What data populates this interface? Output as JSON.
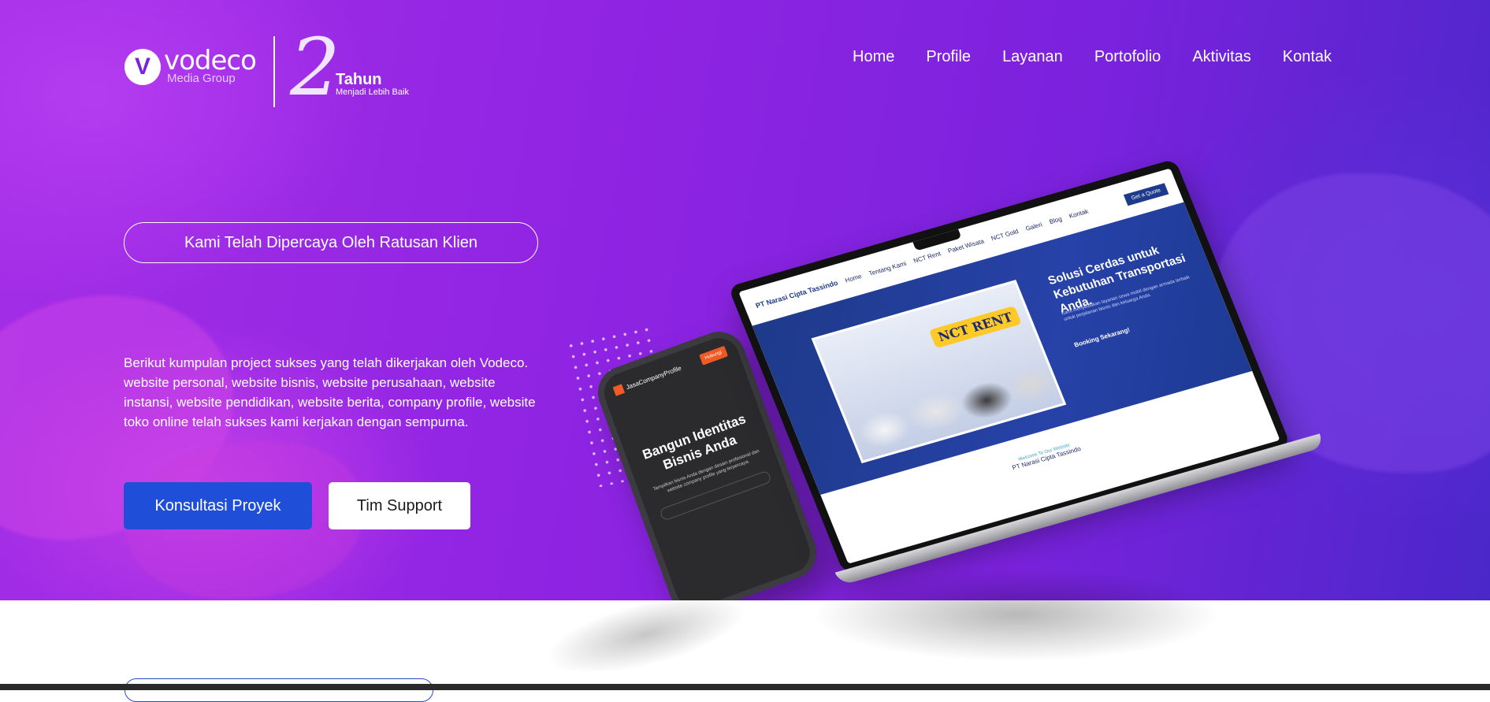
{
  "brand": {
    "logo_letter": "V",
    "name": "vodeco",
    "tagline": "Media Group",
    "anniversary_number": "2",
    "anniversary_title": "Tahun",
    "anniversary_subtitle": "Menjadi Lebih Baik"
  },
  "nav": {
    "items": [
      "Home",
      "Profile",
      "Layanan",
      "Portofolio",
      "Aktivitas",
      "Kontak"
    ]
  },
  "hero": {
    "trust_label": "Kami Telah Dipercaya Oleh Ratusan Klien",
    "description": "Berikut kumpulan project sukses yang telah dikerjakan oleh Vodeco. website personal, website bisnis, website perusahaan, website instansi, website pendidikan, website berita, company profile, website toko online telah sukses kami kerjakan dengan sempurna.",
    "primary_button": "Konsultasi Proyek",
    "secondary_button": "Tim Support"
  },
  "mockup_phone": {
    "logo": "JasaCompanyProfile",
    "cta": "Hubungi",
    "headline": "Bangun Identitas Bisnis Anda",
    "body": "Tampilkan bisnis Anda dengan desain profesional dan website company profile yang terpercaya."
  },
  "mockup_laptop": {
    "logo": "PT Narasi Cipta Tassindo",
    "quote_button": "Get a Quote",
    "nav_links": [
      "Home",
      "Tentang Kami",
      "NCT Rent",
      "Paket Wisata",
      "NCT Gold",
      "Galeri",
      "Blog",
      "Kontak"
    ],
    "badge": "NCT RENT",
    "headline": "Solusi Cerdas untuk Kebutuhan Transportasi Anda.",
    "body": "Kami menyediakan layanan sewa mobil dengan armada terbaik untuk perjalanan bisnis dan keluarga Anda.",
    "cta": "Booking Sekarang!",
    "welcome_small": "Welcome To Our Website",
    "welcome": "PT Narasi Cipta Tassindo"
  },
  "colors": {
    "hero_start": "#a42ee6",
    "hero_end": "#4a27c9",
    "primary_button": "#1f4fd8",
    "secondary_button": "#ffffff"
  }
}
